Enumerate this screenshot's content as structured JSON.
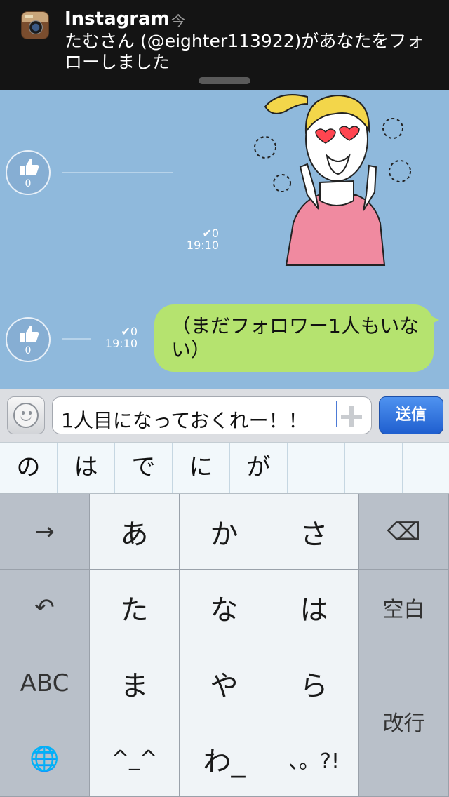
{
  "notification": {
    "app": "Instagram",
    "time": "今",
    "message": "たむさん (@eighter113922)があなたをフォローしました"
  },
  "chat": {
    "messages": [
      {
        "type": "sticker",
        "likes": "0",
        "read": "✔0",
        "time": "19:10"
      },
      {
        "type": "text",
        "likes": "0",
        "read": "✔0",
        "time": "19:10",
        "text": "（まだフォロワー1人もいない）"
      }
    ]
  },
  "input": {
    "value": "1人目になっておくれー！！",
    "send_label": "送信"
  },
  "candidates": [
    "の",
    "は",
    "で",
    "に",
    "が"
  ],
  "keyboard": {
    "row1": [
      "→",
      "あ",
      "か",
      "さ",
      "⌫"
    ],
    "row2": [
      "↶",
      "た",
      "な",
      "は",
      "空白"
    ],
    "row3": [
      "ABC",
      "ま",
      "や",
      "ら"
    ],
    "row4": [
      "🌐",
      "^_^",
      "わ_",
      "、。?!"
    ],
    "enter": "改行"
  },
  "colors": {
    "chat_bg": "#8fb9dc",
    "bubble": "#b5e36f",
    "send": "#2a6fdc"
  }
}
